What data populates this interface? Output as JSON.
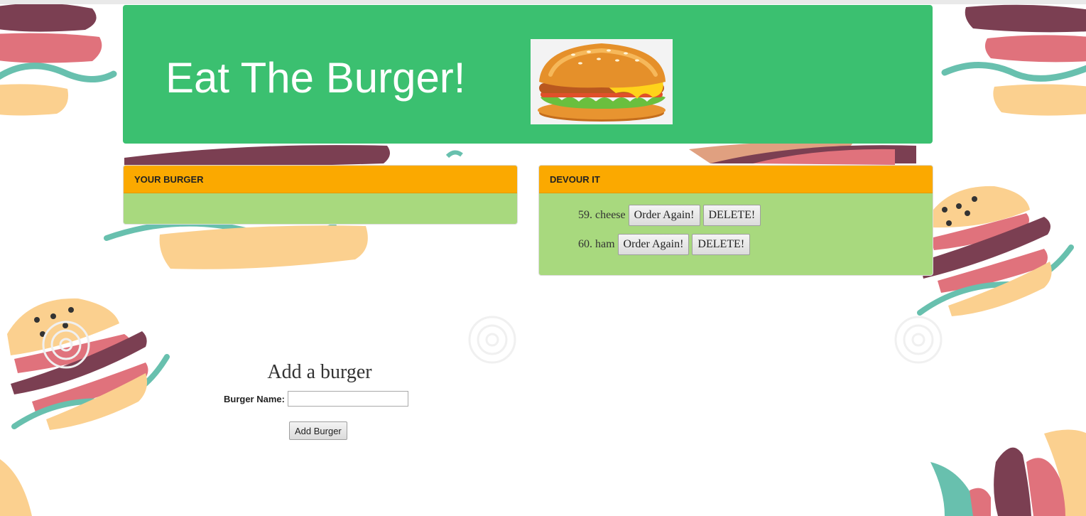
{
  "header": {
    "title": "Eat The Burger!",
    "image_icon": "burger-image"
  },
  "panels": {
    "your_burger": {
      "heading": "YOUR BURGER",
      "items": []
    },
    "devour_it": {
      "heading": "DEVOUR IT",
      "items": [
        {
          "label": "59. cheese",
          "order_again": "Order Again!",
          "delete": "DELETE!"
        },
        {
          "label": "60. ham",
          "order_again": "Order Again!",
          "delete": "DELETE!"
        }
      ]
    }
  },
  "form": {
    "heading": "Add a burger",
    "label": "Burger Name:",
    "input_value": "",
    "input_placeholder": "",
    "submit_label": "Add Burger"
  },
  "colors": {
    "header_bg": "#3bc070",
    "panel_heading_bg": "#fba900",
    "panel_body_bg": "#a8d97e",
    "background": "#ffffff"
  }
}
